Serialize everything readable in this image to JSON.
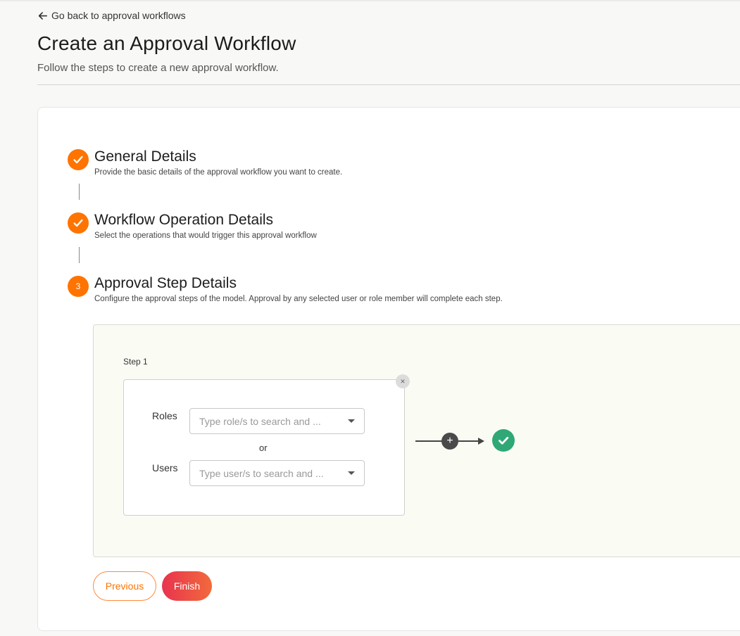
{
  "header": {
    "back_link": "Go back to approval workflows",
    "title": "Create an Approval Workflow",
    "subtitle": "Follow the steps to create a new approval workflow."
  },
  "wizard": {
    "steps": [
      {
        "badge": "",
        "title": "General Details",
        "description": "Provide the basic details of the approval workflow you want to create.",
        "state": "completed",
        "icon": "checkmark-icon"
      },
      {
        "badge": "",
        "title": "Workflow Operation Details",
        "description": "Select the operations that would trigger this approval workflow",
        "state": "completed",
        "icon": "checkmark-icon"
      },
      {
        "badge": "3",
        "title": "Approval Step Details",
        "description": "Configure the approval steps of the model. Approval by any selected user or role member will complete each step.",
        "state": "active"
      }
    ]
  },
  "approval_step": {
    "label": "Step 1",
    "remove_icon": "×",
    "roles_label": "Roles",
    "roles_placeholder": "Type role/s to search and ...",
    "or_text": "or",
    "users_label": "Users",
    "users_placeholder": "Type user/s to search and ...",
    "add_icon": "+"
  },
  "actions": {
    "previous_label": "Previous",
    "finish_label": "Finish"
  },
  "colors": {
    "accent": "#ff7300",
    "success": "#2fa876",
    "finish_gradient_start": "#e8334f",
    "finish_gradient_end": "#f26a3b"
  }
}
